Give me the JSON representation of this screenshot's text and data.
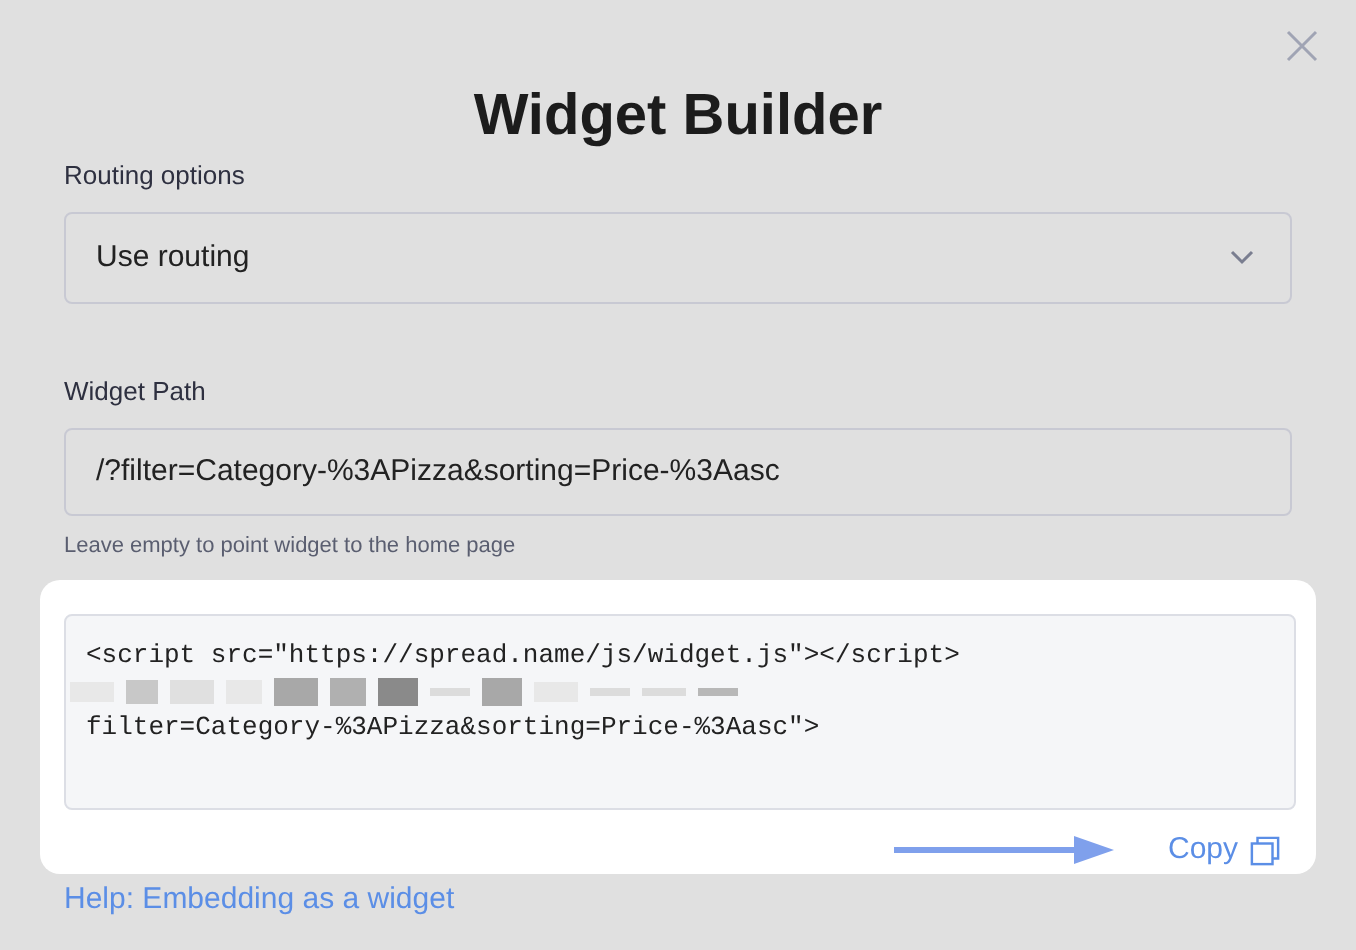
{
  "dialog": {
    "title": "Widget Builder"
  },
  "routing": {
    "label": "Routing options",
    "value": "Use routing"
  },
  "widget_path": {
    "label": "Widget Path",
    "value": "/?filter=Category-%3APizza&sorting=Price-%3Aasc",
    "hint": "Leave empty to point widget to the home page"
  },
  "embed_code": {
    "lines": [
      "<script src=\"https://spread.name/js/widget.js\"></script>",
      "filter=Category-%3APizza&sorting=Price-%3Aasc\">"
    ]
  },
  "copy_button": {
    "label": "Copy"
  },
  "help_link": "Help: Embedding as a widget"
}
